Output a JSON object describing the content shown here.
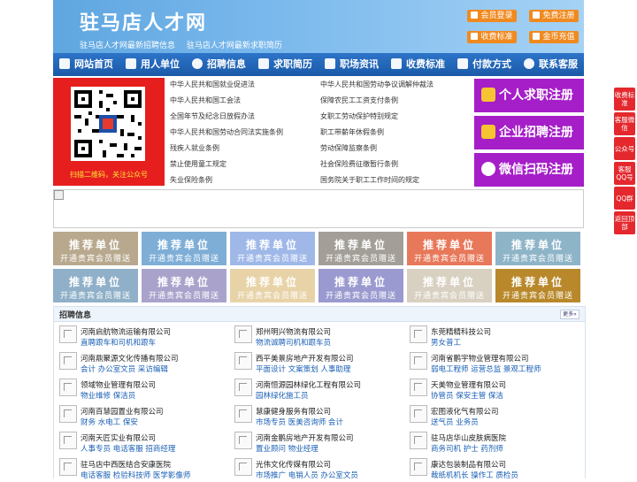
{
  "header": {
    "title": "驻马店人才网",
    "subtitle_1": "驻马店人才网最新招聘信息",
    "subtitle_2": "驻马店人才网最新求职简历",
    "buttons": [
      "会员登录",
      "免费注册",
      "收费标准",
      "金币充值"
    ]
  },
  "nav": [
    "网站首页",
    "用人单位",
    "招聘信息",
    "求职简历",
    "职场资讯",
    "收费标准",
    "付款方式",
    "联系客服"
  ],
  "qr": {
    "caption": "扫描二维码，关注公众号"
  },
  "laws": [
    [
      "中华人民共和国就业促进法",
      "中华人民共和国劳动争议调解仲裁法"
    ],
    [
      "中华人民共和国工会法",
      "保障农民工工资支付条例"
    ],
    [
      "全国年节及纪念日放假办法",
      "女职工劳动保护特别规定"
    ],
    [
      "中华人民共和国劳动合同法实施条例",
      "职工带薪年休假条例"
    ],
    [
      "残疾人就业条例",
      "劳动保障监察条例"
    ],
    [
      "禁止使用童工规定",
      "社会保险费征缴暂行条例"
    ],
    [
      "失业保险条例",
      "国务院关于职工工作时间的规定"
    ]
  ],
  "register": [
    "个人求职注册",
    "企业招聘注册",
    "微信扫码注册"
  ],
  "recommend": {
    "title": "推荐单位",
    "sub": "开通贵宾会员赠送",
    "colors": [
      "#b8a98e",
      "#7eaed6",
      "#9fb8e8",
      "#a39f98",
      "#e8785a",
      "#8eb4c8",
      "#8fb0c8",
      "#a9a3cc",
      "#e8d3a8",
      "#9a9ad0",
      "#d8d0c0",
      "#b8882a"
    ]
  },
  "jobs": {
    "title": "招聘信息",
    "more": "更多»",
    "items": [
      {
        "company": "河南启航物流运输有限公司",
        "positions": "直聘跟车和司机和跟车"
      },
      {
        "company": "郑州明兴物流有限公司",
        "positions": "物流诚聘司机和跟车员"
      },
      {
        "company": "东莞精精科技公司",
        "positions": "男女普工"
      },
      {
        "company": "河南鼎聚源文化传播有限公司",
        "positions": "会计 办公室文员 采访编辑"
      },
      {
        "company": "西平美景房地产开发有限公司",
        "positions": "平面设计 文案策划 人事助理"
      },
      {
        "company": "河南省鹏宇物业管理有限公司",
        "positions": "弱电工程师 运营总监 景观工程师"
      },
      {
        "company": "领域物业管理有限公司",
        "positions": "物业维修 保洁员"
      },
      {
        "company": "河南恒源园林绿化工程有限公司",
        "positions": "园林绿化施工员"
      },
      {
        "company": "天美物业管理有限公司",
        "positions": "协管员 保安主管 保洁"
      },
      {
        "company": "河南百慧园置业有限公司",
        "positions": "财务 水电工 保安"
      },
      {
        "company": "慧康健身服务有限公司",
        "positions": "市场专员 医美咨询师 会计"
      },
      {
        "company": "宏图液化气有限公司",
        "positions": "送气员 业务员"
      },
      {
        "company": "河南天匠实业有限公司",
        "positions": "人事专员 电话客服 招商经理"
      },
      {
        "company": "河南金鹏房地产开发有限公司",
        "positions": "置业顾问 物业经理"
      },
      {
        "company": "驻马店华山皮肤病医院",
        "positions": "商务司机 护士 药剂师"
      },
      {
        "company": "驻马店中西医结合安康医院",
        "positions": "电话客服 检验科技师 医学影像师"
      },
      {
        "company": "光伟文化传媒有限公司",
        "positions": "市场推广 电销人员 办公室文员"
      },
      {
        "company": "康达包装制品有限公司",
        "positions": "裁纸机机长 操作工 质检员"
      }
    ]
  },
  "sidebar": [
    "收费标准",
    "客服微信",
    "公众号",
    "客服QQ号",
    "QQ群",
    "返回顶部"
  ]
}
